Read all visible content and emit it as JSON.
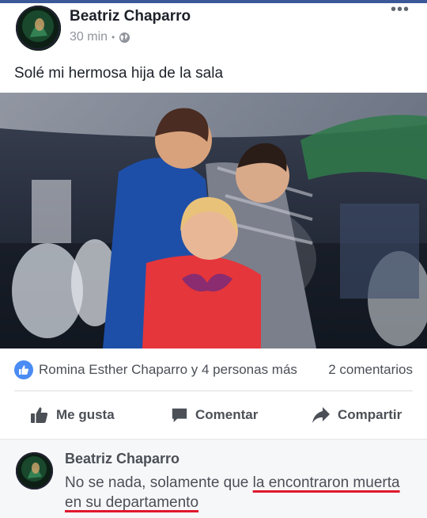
{
  "post": {
    "author": "Beatriz Chaparro",
    "time": "30 min",
    "separator": "•",
    "privacy_icon": "globe-icon",
    "more_icon": "more-options-icon",
    "more_glyph": "•••",
    "text": "Solé mi hermosa hija de la sala"
  },
  "reactions": {
    "icon": "like-badge-icon",
    "names": "Romina Esther Chaparro y 4 personas más",
    "comments_count": "2 comentarios"
  },
  "actions": {
    "like_label": "Me gusta",
    "comment_label": "Comentar",
    "share_label": "Compartir"
  },
  "comment": {
    "author": "Beatriz Chaparro",
    "text_part1": "No se nada,  solamente que ",
    "text_part2": "la encontraron muerta en su departamento"
  },
  "colors": {
    "brand": "#3b5998",
    "like_blue": "#4a8bf5",
    "annotation_red": "#e0182d"
  }
}
